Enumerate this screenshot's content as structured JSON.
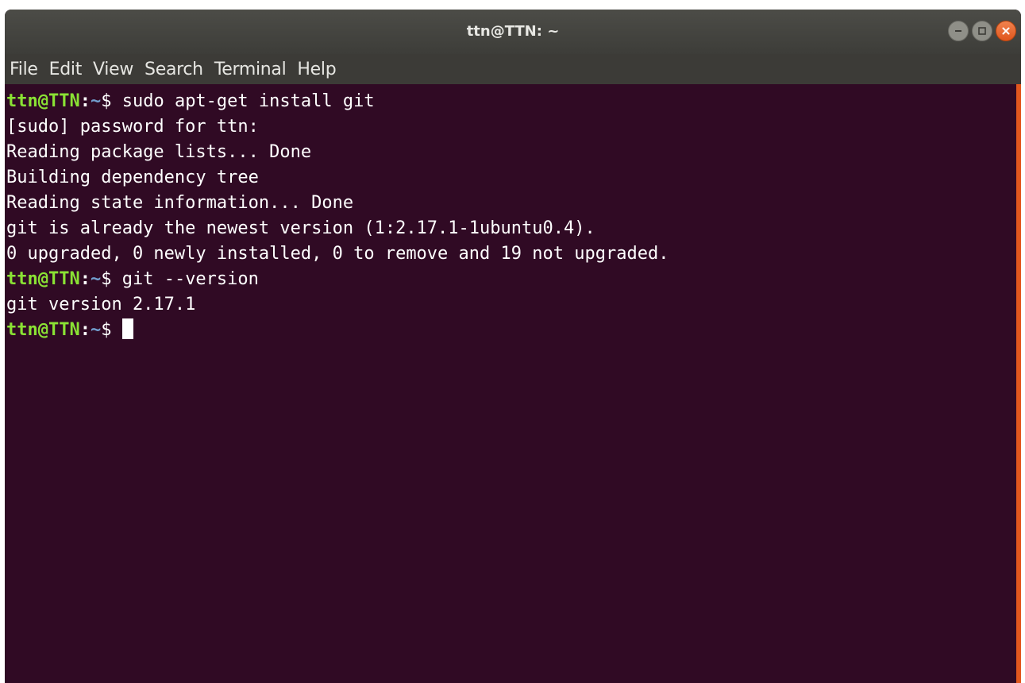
{
  "window": {
    "title": "ttn@TTN: ~"
  },
  "menu": {
    "items": [
      "File",
      "Edit",
      "View",
      "Search",
      "Terminal",
      "Help"
    ]
  },
  "prompt": {
    "user_host": "ttn@TTN",
    "separator": ":",
    "path": "~",
    "symbol": "$ "
  },
  "terminal": {
    "lines": [
      {
        "type": "command",
        "text": "sudo apt-get install git"
      },
      {
        "type": "output",
        "text": "[sudo] password for ttn:"
      },
      {
        "type": "output",
        "text": "Reading package lists... Done"
      },
      {
        "type": "output",
        "text": "Building dependency tree"
      },
      {
        "type": "output",
        "text": "Reading state information... Done"
      },
      {
        "type": "output",
        "text": "git is already the newest version (1:2.17.1-1ubuntu0.4)."
      },
      {
        "type": "output",
        "text": "0 upgraded, 0 newly installed, 0 to remove and 19 not upgraded."
      },
      {
        "type": "command",
        "text": "git --version"
      },
      {
        "type": "output",
        "text": "git version 2.17.1"
      },
      {
        "type": "command",
        "text": ""
      }
    ]
  },
  "icons": {
    "minimize": "minimize-icon",
    "maximize": "maximize-icon",
    "close": "close-icon"
  },
  "colors": {
    "background": "#300a24",
    "prompt_user": "#8ae234",
    "prompt_path": "#729fcf",
    "close_button": "#e0561d"
  }
}
